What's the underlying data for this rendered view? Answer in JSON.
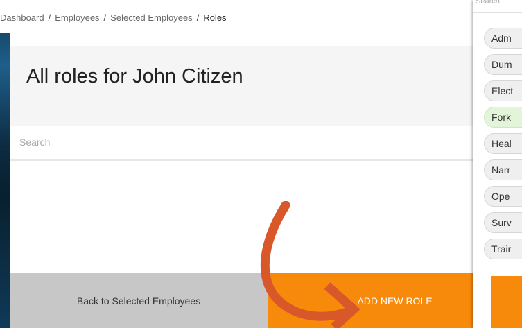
{
  "breadcrumb": {
    "items": [
      "Dashboard",
      "Employees",
      "Selected Employees"
    ],
    "current": "Roles",
    "separator": "/"
  },
  "page": {
    "title": "All roles for John Citizen"
  },
  "search": {
    "placeholder": "Search"
  },
  "footer": {
    "back_label": "Back to Selected Employees",
    "add_label": "ADD NEW ROLE"
  },
  "side_panel": {
    "search_placeholder": "Search",
    "roles": [
      {
        "label": "Adm",
        "active": false
      },
      {
        "label": "Dum",
        "active": false
      },
      {
        "label": "Elect",
        "active": false
      },
      {
        "label": "Fork",
        "active": true
      },
      {
        "label": "Heal",
        "active": false
      },
      {
        "label": "Narr",
        "active": false
      },
      {
        "label": "Ope",
        "active": false
      },
      {
        "label": "Surv",
        "active": false
      },
      {
        "label": "Trair",
        "active": false
      }
    ]
  },
  "colors": {
    "accent": "#f7890b",
    "arrow": "#d9582a",
    "active_chip": "#e3f5d9"
  }
}
